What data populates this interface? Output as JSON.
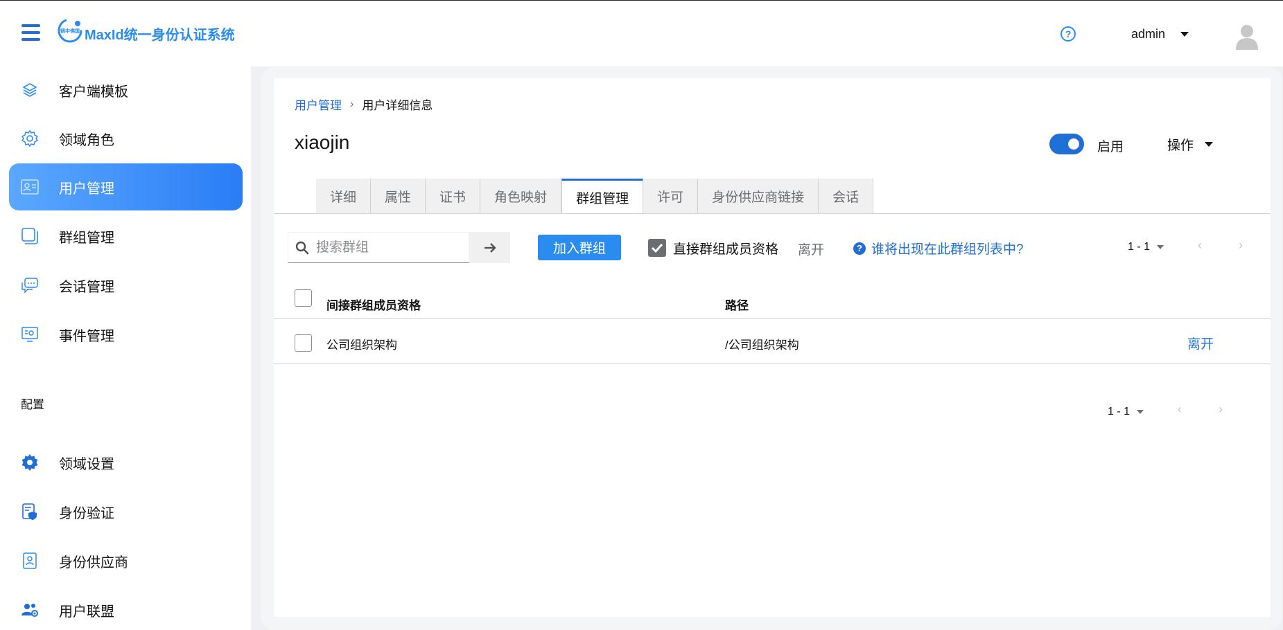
{
  "header": {
    "brand": "MaxId统一身份认证系统",
    "logo_text": "镜中佛国",
    "username": "admin"
  },
  "sidebar": {
    "items": [
      {
        "label": "客户端模板",
        "icon": "layers-icon"
      },
      {
        "label": "领域角色",
        "icon": "gear-outline-icon"
      },
      {
        "label": "用户管理",
        "icon": "user-card-icon",
        "active": true
      },
      {
        "label": "群组管理",
        "icon": "group-square-icon"
      },
      {
        "label": "会话管理",
        "icon": "chat-icon"
      },
      {
        "label": "事件管理",
        "icon": "event-monitor-icon"
      }
    ],
    "section_title": "配置",
    "config_items": [
      {
        "label": "领域设置",
        "icon": "gear-filled-icon"
      },
      {
        "label": "身份验证",
        "icon": "shield-doc-icon"
      },
      {
        "label": "身份供应商",
        "icon": "id-badge-icon"
      },
      {
        "label": "用户联盟",
        "icon": "users-federation-icon"
      }
    ]
  },
  "breadcrumb": {
    "parent": "用户管理",
    "current": "用户详细信息"
  },
  "page": {
    "title": "xiaojin",
    "enabled_label": "启用",
    "enabled": true,
    "actions_label": "操作"
  },
  "tabs": [
    "详细",
    "属性",
    "证书",
    "角色映射",
    "群组管理",
    "许可",
    "身份供应商链接",
    "会话"
  ],
  "active_tab": "群组管理",
  "toolbar": {
    "search_placeholder": "搜索群组",
    "join_button": "加入群组",
    "direct_membership_label": "直接群组成员资格",
    "direct_membership_checked": true,
    "leave_label": "离开",
    "help_link": "谁将出现在此群组列表中?",
    "pagination": "1 - 1"
  },
  "table": {
    "columns": [
      "间接群组成员资格",
      "路径"
    ],
    "rows": [
      {
        "name": "公司组织架构",
        "path": "/公司组织架构",
        "action": "离开"
      }
    ]
  },
  "footer_pagination": "1 - 1"
}
